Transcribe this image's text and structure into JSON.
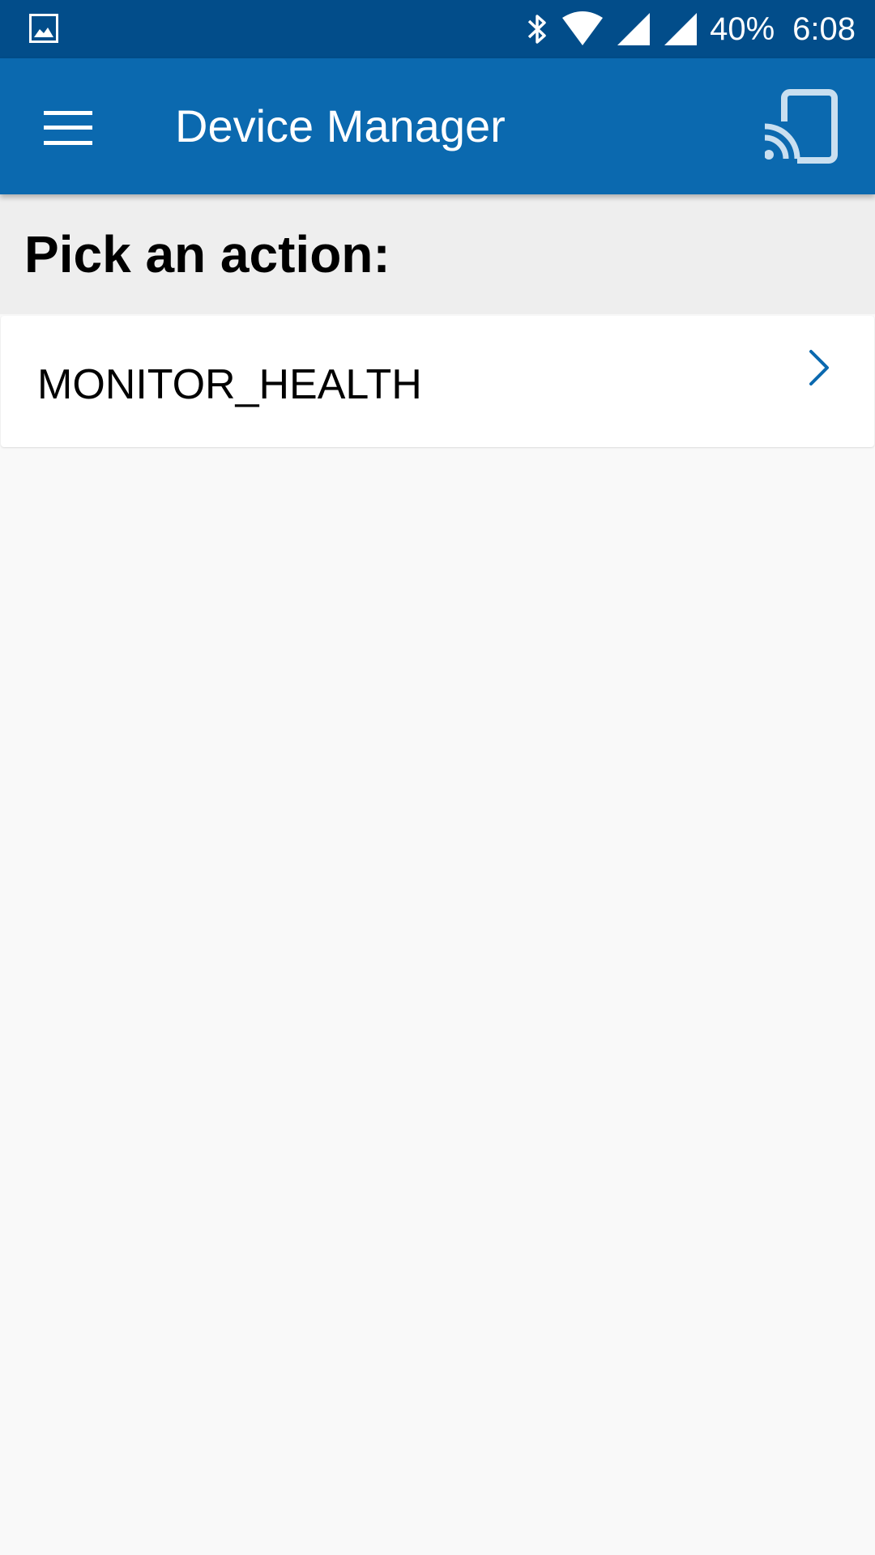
{
  "status_bar": {
    "battery": "40%",
    "time": "6:08",
    "icons": [
      "image-notification-icon",
      "bluetooth-icon",
      "wifi-icon",
      "signal-icon",
      "signal-icon"
    ]
  },
  "app_bar": {
    "title": "Device Manager",
    "menu_icon": "hamburger-menu-icon",
    "action_icon": "cast-icon",
    "color": "#0b69af"
  },
  "section": {
    "title": "Pick an action:"
  },
  "actions": [
    {
      "label": "MONITOR_HEALTH",
      "icon": "chevron-right-icon"
    }
  ],
  "colors": {
    "status_bar": "#024d8a",
    "accent": "#0b69af",
    "section_bg": "#eeeeee",
    "page_bg": "#f9f9f9"
  }
}
